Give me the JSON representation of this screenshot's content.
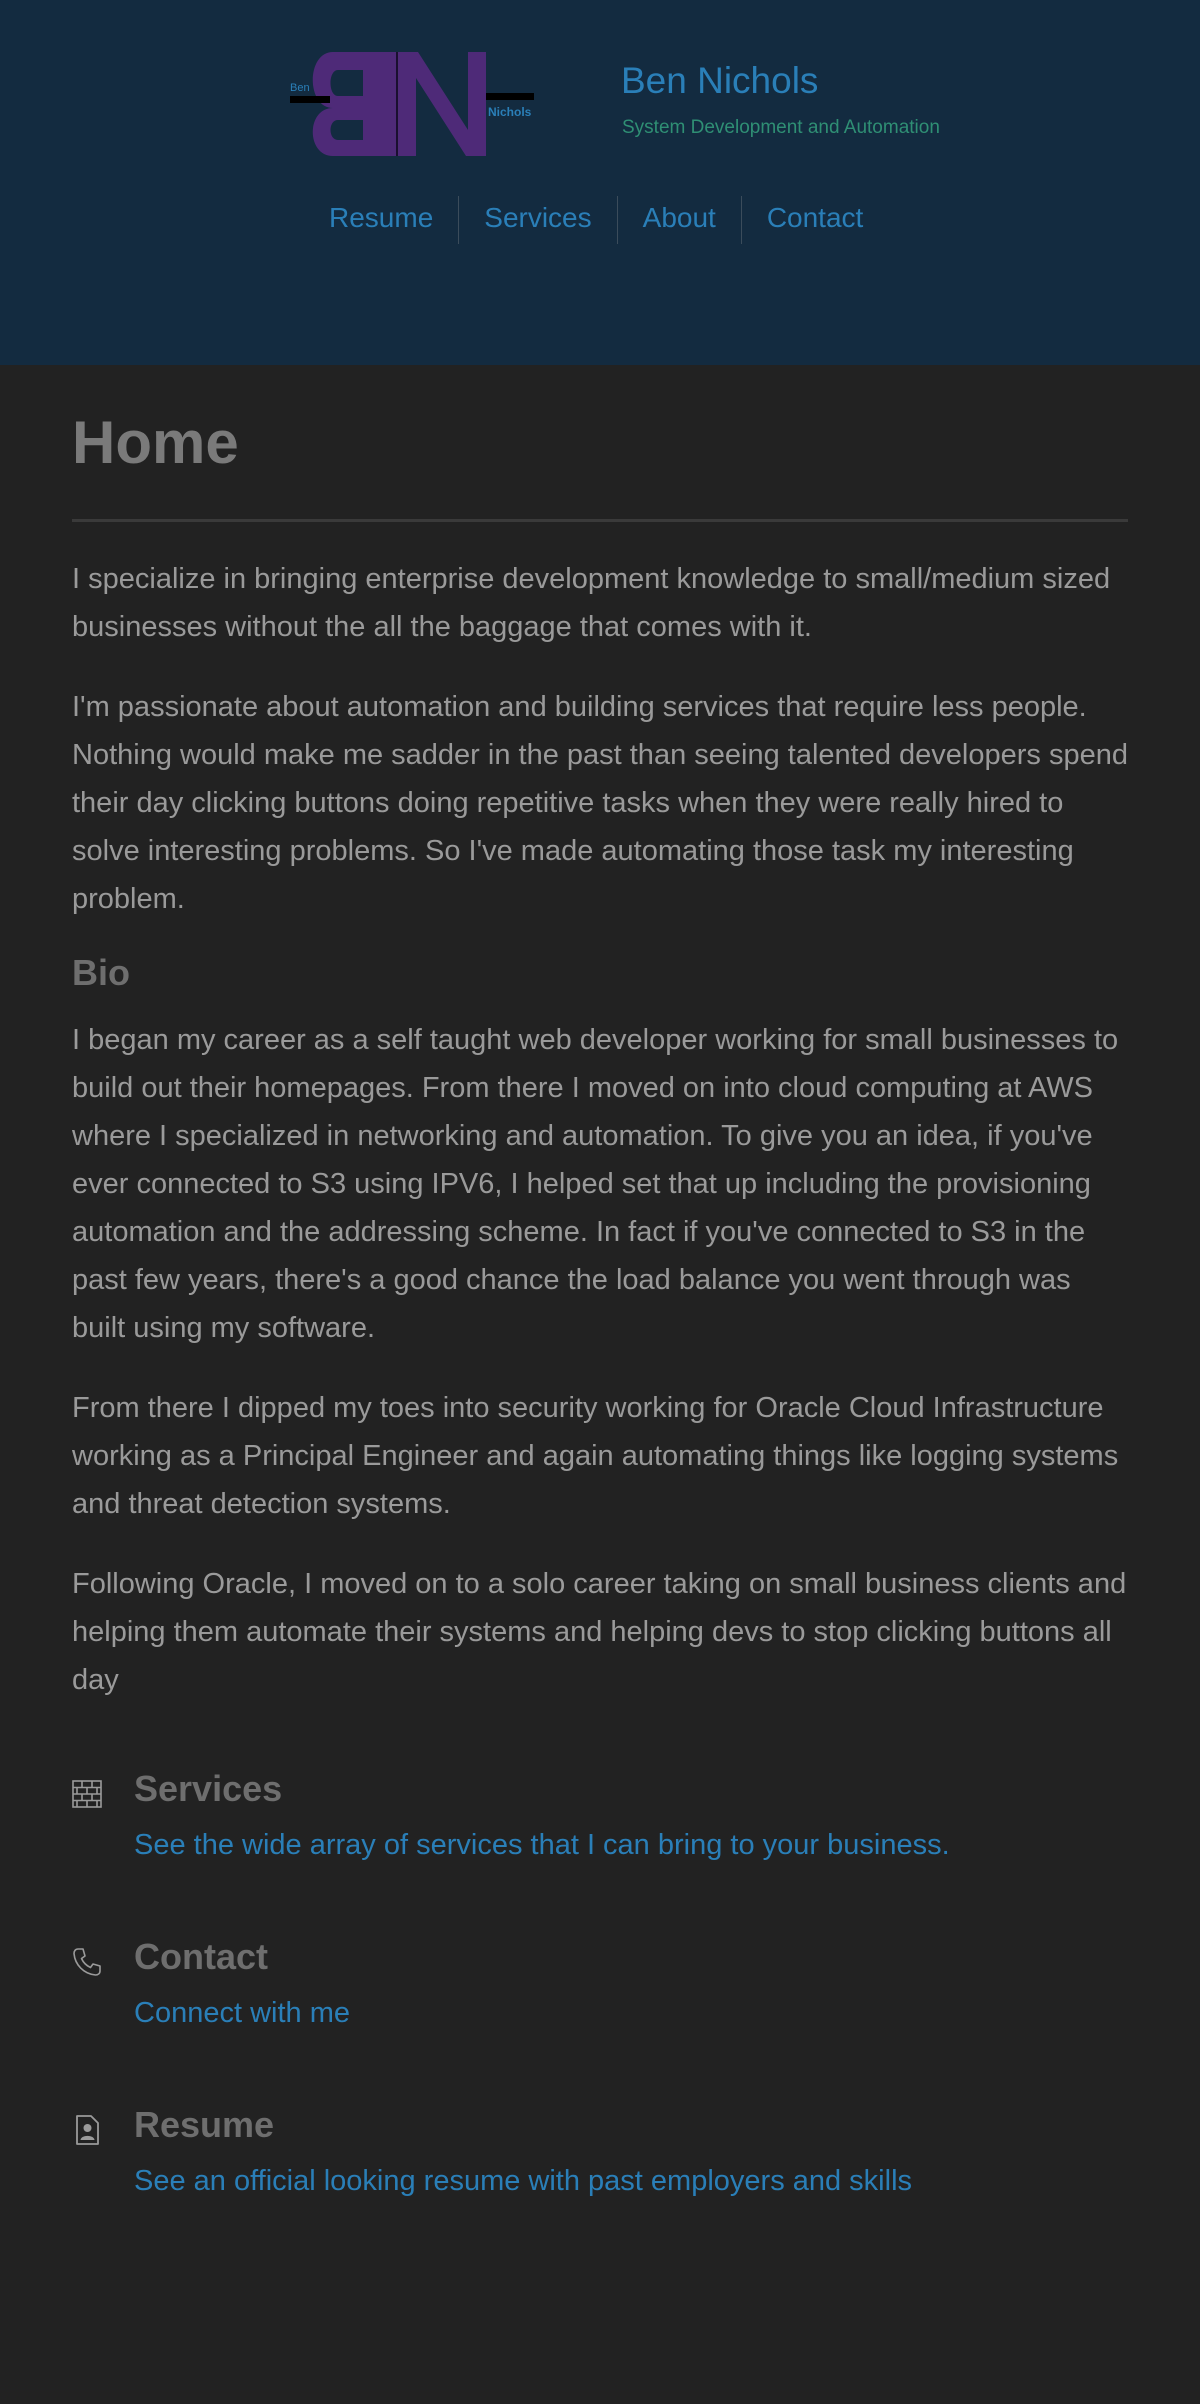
{
  "header": {
    "logo": {
      "letters": "BN",
      "small_left": "Ben",
      "small_right": "Nichols"
    },
    "name": "Ben Nichols",
    "tagline": "System Development and Automation",
    "nav": [
      "Resume",
      "Services",
      "About",
      "Contact"
    ]
  },
  "home": {
    "title": "Home",
    "paragraphs": [
      "I specialize in bringing enterprise development knowledge to small/medium sized businesses without the all the baggage that comes with it.",
      "I'm passionate about automation and building services that require less people. Nothing would make me sadder in the past than seeing talented developers spend their day clicking buttons doing repetitive tasks when they were really hired to solve interesting problems. So I've made automating those task my interesting problem."
    ]
  },
  "bio": {
    "title": "Bio",
    "paragraphs": [
      "I began my career as a self taught web developer working for small businesses to build out their homepages. From there I moved on into cloud computing at AWS where I specialized in networking and automation. To give you an idea, if you've ever connected to S3 using IPV6, I helped set that up including the provisioning automation and the addressing scheme. In fact if you've connected to S3 in the past few years, there's a good chance the load balance you went through was built using my software.",
      "From there I dipped my toes into security working for Oracle Cloud Infrastructure working as a Principal Engineer and again automating things like logging systems and threat detection systems.",
      "Following Oracle, I moved on to a solo career taking on small business clients and helping them automate their systems and helping devs to stop clicking buttons all day"
    ]
  },
  "features": [
    {
      "icon": "brick-wall-icon",
      "title": "Services",
      "link": "See the wide array of services that I can bring to your business."
    },
    {
      "icon": "phone-icon",
      "title": "Contact",
      "link": "Connect with me"
    },
    {
      "icon": "resume-document-icon",
      "title": "Resume",
      "link": "See an official looking resume with past employers and skills"
    }
  ],
  "colors": {
    "header_bg": "#132b40",
    "page_bg": "#222222",
    "link": "#2a7fb8",
    "tagline": "#2f8f74",
    "logo_purple": "#4e2a78"
  }
}
